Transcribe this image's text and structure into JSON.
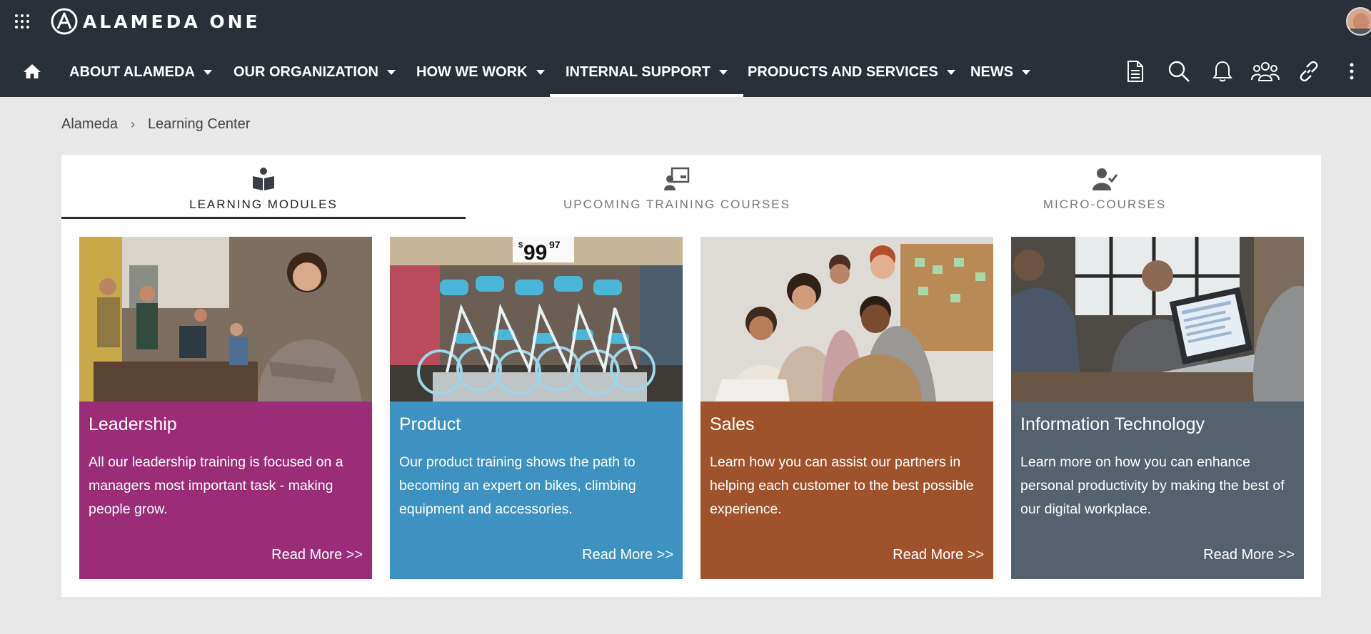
{
  "app": {
    "logo_text": "ALAMEDA ONE"
  },
  "nav": {
    "items": [
      {
        "label": "ABOUT ALAMEDA"
      },
      {
        "label": "OUR ORGANIZATION"
      },
      {
        "label": "HOW WE WORK"
      },
      {
        "label": "INTERNAL SUPPORT",
        "active": true
      },
      {
        "label": "PRODUCTS AND SERVICES"
      },
      {
        "label": "NEWS"
      }
    ],
    "tool_icons": [
      "document-icon",
      "search-icon",
      "bell-icon",
      "people-icon",
      "link-icon",
      "more-vertical-icon"
    ]
  },
  "breadcrumb": {
    "items": [
      "Alameda",
      "Learning Center"
    ],
    "separator": "›"
  },
  "tabs": [
    {
      "label": "LEARNING MODULES",
      "icon": "reading-person-icon",
      "active": true
    },
    {
      "label": "UPCOMING TRAINING COURSES",
      "icon": "presentation-icon"
    },
    {
      "label": "MICRO-COURSES",
      "icon": "user-check-icon"
    }
  ],
  "cards": [
    {
      "title": "Leadership",
      "description": "All our leadership training is focused on a managers most important task - making people grow.",
      "link": "Read More >>",
      "color": "#9b2d78"
    },
    {
      "title": "Product",
      "description": "Our product training shows the path to becoming an expert on bikes, climbing equipment and accessories.",
      "link": "Read More >>",
      "color": "#3d92c1",
      "price_dollar": "$",
      "price_main": "99",
      "price_cents": "97"
    },
    {
      "title": "Sales",
      "description": "Learn how you can assist our partners in helping each customer to the best possible experience.",
      "link": "Read More >>",
      "color": "#a0522d"
    },
    {
      "title": "Information Technology",
      "description": "Learn more on how you can enhance personal productivity by making the best of our digital workplace.",
      "link": "Read More >>",
      "color": "#55616c"
    }
  ],
  "colors": {
    "header_bg": "#2a3038",
    "page_bg": "#e8e8e8"
  }
}
